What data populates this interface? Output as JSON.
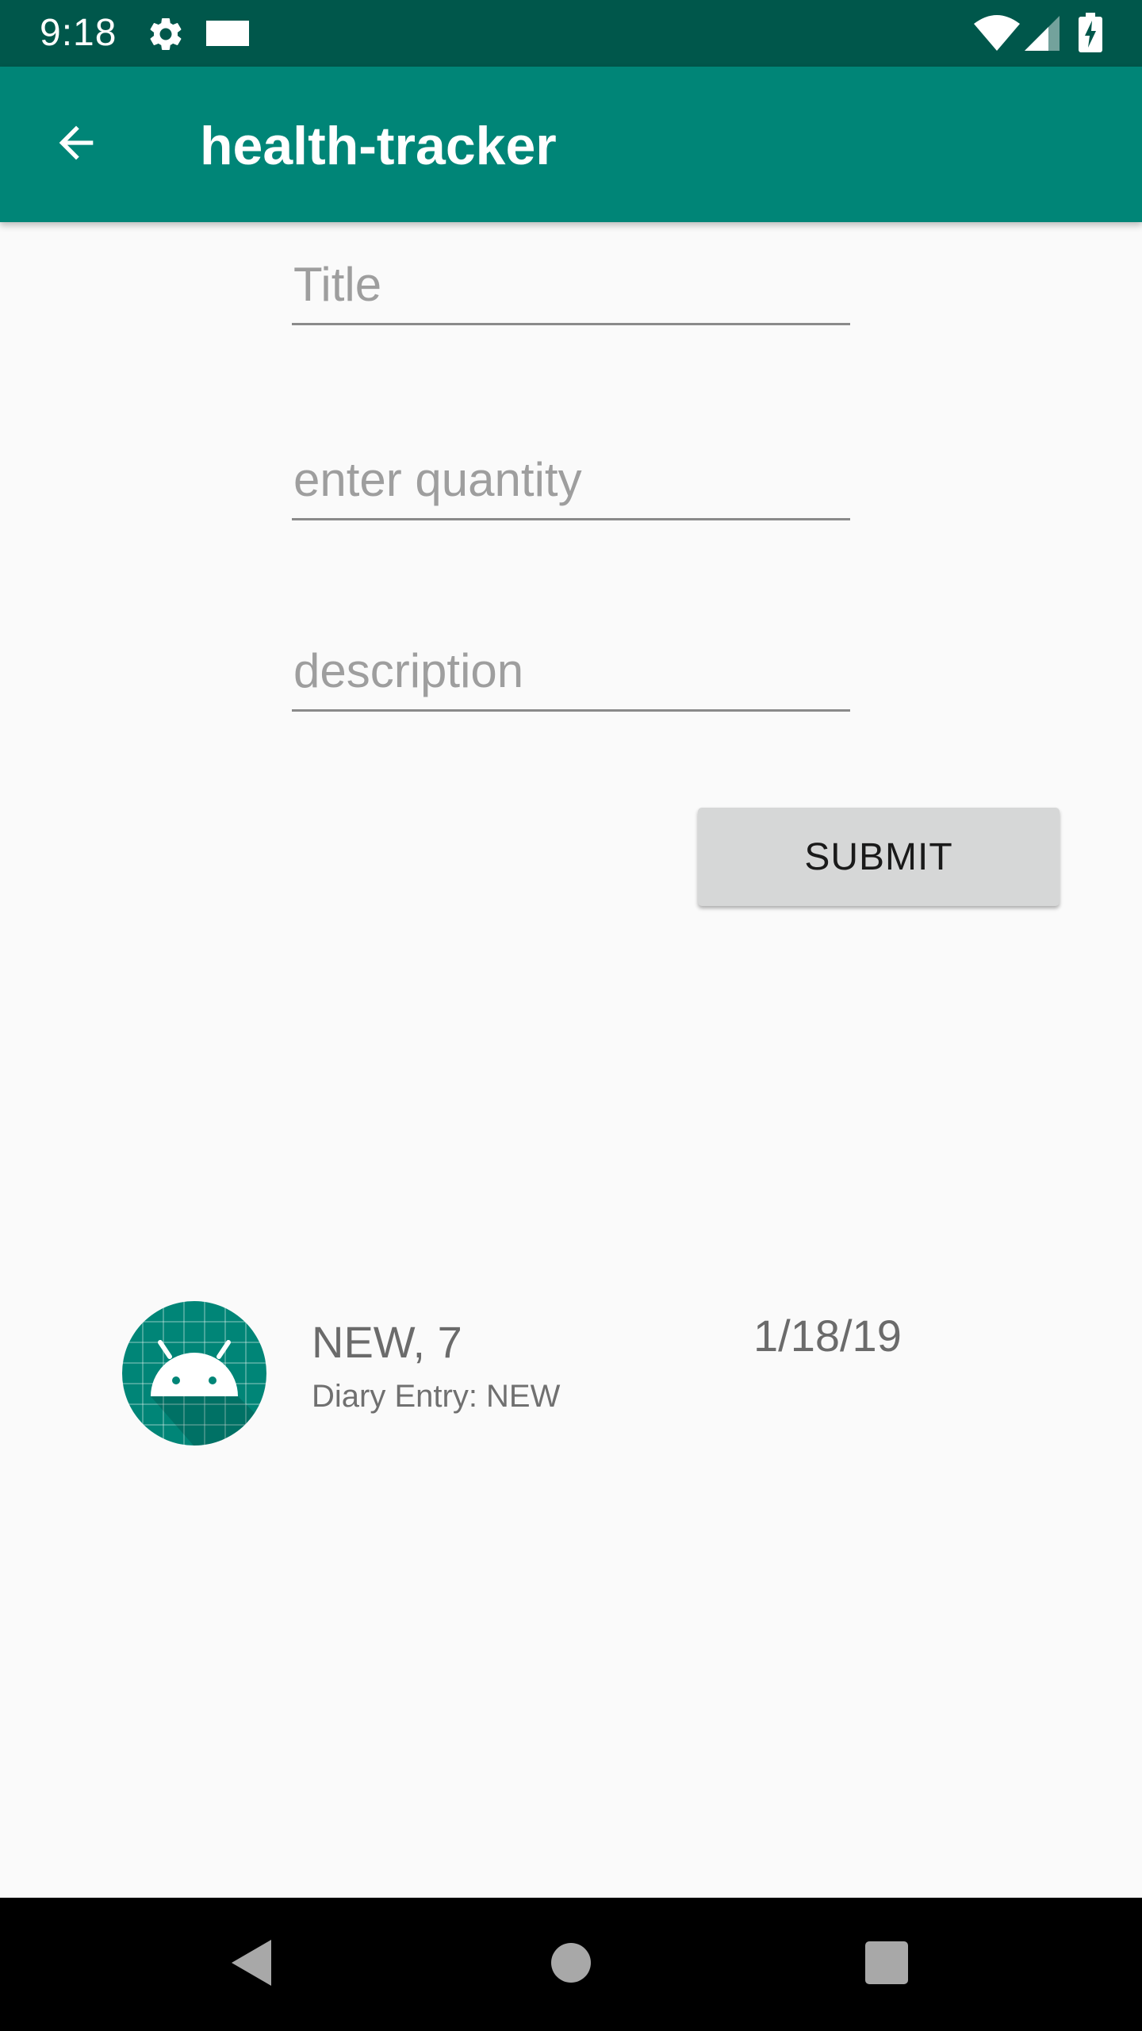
{
  "status_bar": {
    "time": "9:18",
    "icons": [
      "settings-gear-icon",
      "notification-rect-icon",
      "wifi-icon",
      "cell-signal-icon",
      "battery-charging-icon"
    ]
  },
  "app_bar": {
    "title": "health-tracker",
    "back_icon": "arrow-back-icon"
  },
  "form": {
    "title_placeholder": "Title",
    "title_value": "",
    "quantity_placeholder": "enter quantity",
    "quantity_value": "",
    "description_placeholder": "description",
    "description_value": "",
    "submit_label": "SUBMIT"
  },
  "entries": [
    {
      "avatar_icon": "android-robot-icon",
      "title": "NEW, 7",
      "subtitle": "Diary Entry: NEW",
      "date": "1/18/19"
    }
  ],
  "nav_bar": {
    "icons": [
      "back-triangle-icon",
      "home-circle-icon",
      "recents-square-icon"
    ]
  },
  "colors": {
    "status_bar": "#00574b",
    "primary": "#008577",
    "background": "#fafafa",
    "button": "#d6d7d7"
  }
}
